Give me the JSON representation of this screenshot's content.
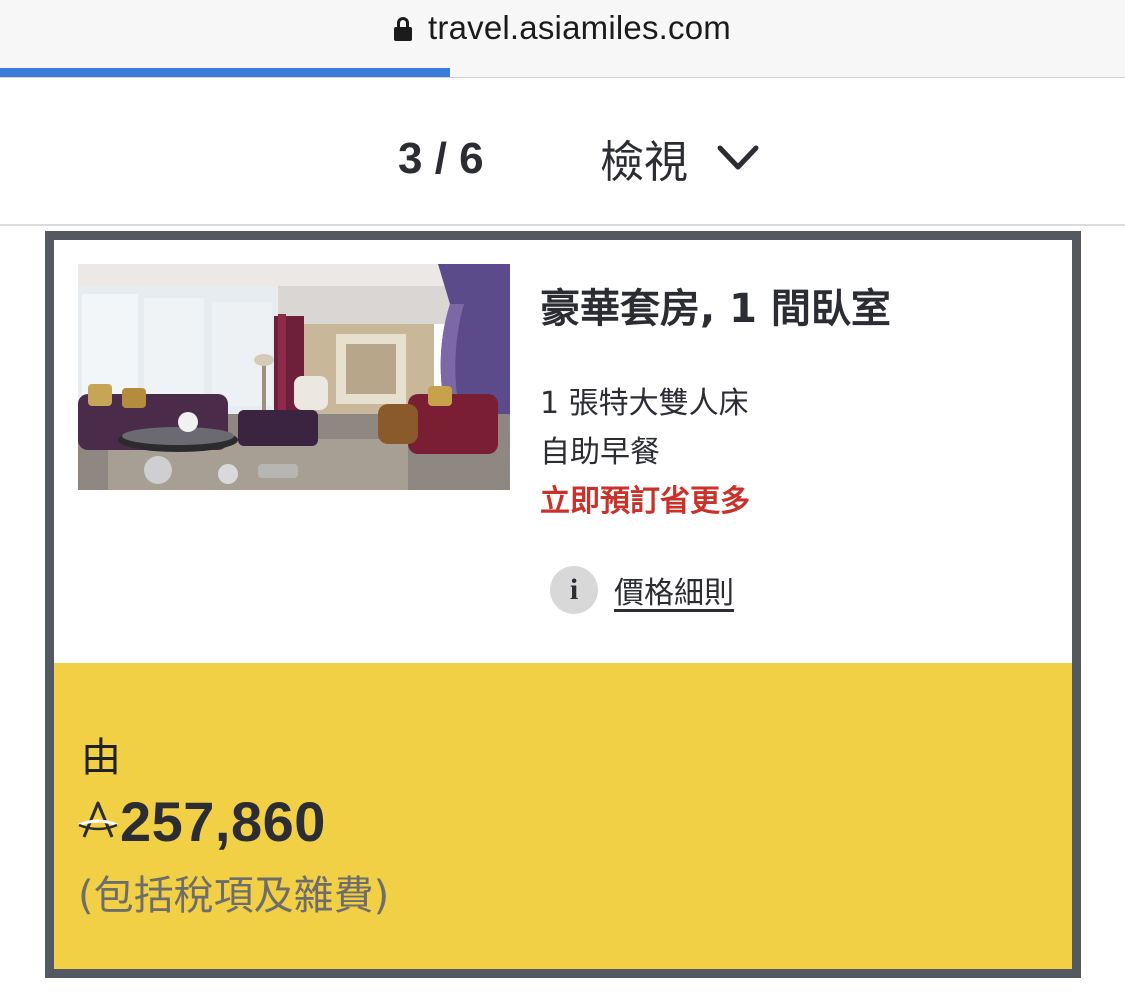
{
  "browser": {
    "url": "travel.asiamiles.com",
    "load_progress": 0.4
  },
  "pager": {
    "count": "3 / 6",
    "view_label": "檢視"
  },
  "room": {
    "title": "豪華套房, 1 間臥室",
    "features": [
      "1 張特大雙人床",
      "自助早餐"
    ],
    "promo": "立即預訂省更多",
    "price_details_label": "價格細則"
  },
  "price": {
    "from_label": "由",
    "amount": "257,860",
    "tax_note": "(包括稅項及雜費)"
  },
  "colors": {
    "accent_blue": "#3a7bdc",
    "price_panel": "#f2d046",
    "promo_red": "#c8322a",
    "card_border": "#545860"
  }
}
